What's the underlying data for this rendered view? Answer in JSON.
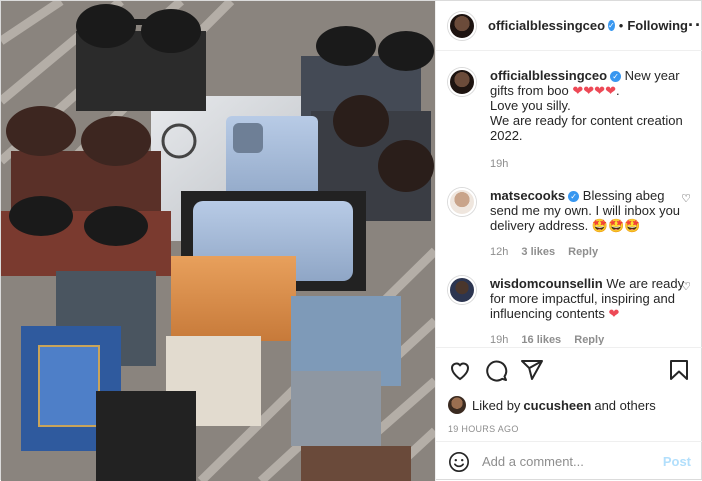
{
  "post": {
    "username": "officialblessingceo",
    "follow_state": "Following",
    "more": "···"
  },
  "caption": {
    "username": "officialblessingceo",
    "text_line1": "New year gifts from boo",
    "hearts": "❤❤❤❤",
    "text_line2": "Love you silly.",
    "text_line3": "We are ready for content creation 2022.",
    "time": "19h"
  },
  "comments": [
    {
      "username": "matsecooks",
      "text": "Blessing abeg send me my own. I will inbox you delivery address.",
      "emoji": "🤩🤩🤩",
      "time": "12h",
      "likes": "3 likes",
      "reply": "Reply"
    },
    {
      "username": "wisdomcounsellin",
      "text": "We are ready for more impactful, inspiring and influencing contents",
      "emoji": "❤",
      "time": "19h",
      "likes": "16 likes",
      "reply": "Reply"
    }
  ],
  "likes": {
    "prefix": "Liked by",
    "user": "cucusheen",
    "suffix": "and others"
  },
  "timestamp": "19 HOURS AGO",
  "add_comment": {
    "placeholder": "Add a comment...",
    "post_label": "Post"
  },
  "icons": {
    "like": "heart-icon",
    "comment": "comment-icon",
    "share": "share-icon",
    "save": "bookmark-icon",
    "emoji": "emoji-icon"
  }
}
